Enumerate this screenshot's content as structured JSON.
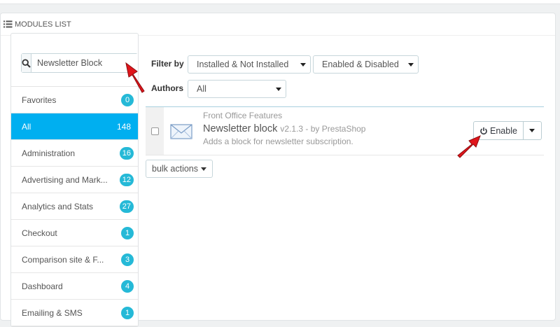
{
  "panel": {
    "title": "Modules list"
  },
  "search": {
    "value": "Newsletter Block",
    "icon": "search-icon"
  },
  "categories": [
    {
      "label": "Favorites",
      "count": "0"
    },
    {
      "label": "All",
      "count": "148",
      "active": true
    },
    {
      "label": "Administration",
      "count": "16"
    },
    {
      "label": "Advertising and Mark...",
      "count": "12"
    },
    {
      "label": "Analytics and Stats",
      "count": "27"
    },
    {
      "label": "Checkout",
      "count": "1"
    },
    {
      "label": "Comparison site & F...",
      "count": "3"
    },
    {
      "label": "Dashboard",
      "count": "4"
    },
    {
      "label": "Emailing & SMS",
      "count": "1"
    }
  ],
  "filters": {
    "filter_by_label": "Filter by",
    "install_select": "Installed & Not Installed",
    "enable_select": "Enabled & Disabled",
    "authors_label": "Authors",
    "authors_select": "All"
  },
  "module": {
    "category": "Front Office Features",
    "name": "Newsletter block",
    "version": "v2.1.3 - by PrestaShop",
    "description": "Adds a block for newsletter subscription.",
    "enable_label": "Enable",
    "icon": "envelope-icon"
  },
  "bulk": {
    "label": "bulk actions"
  },
  "colors": {
    "accent": "#00aff0",
    "badge": "#25b9d7",
    "arrow": "#e0151b"
  }
}
